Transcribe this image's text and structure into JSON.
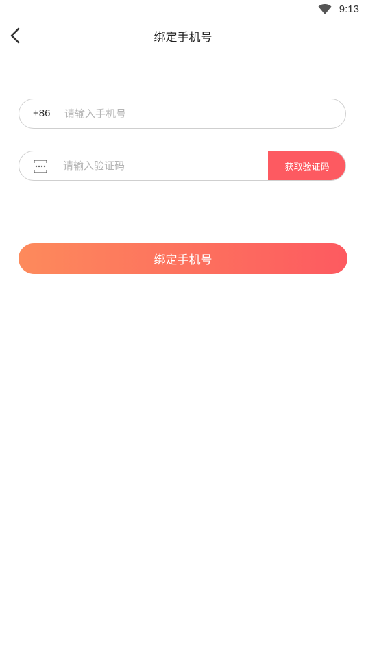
{
  "status_bar": {
    "time": "9:13",
    "wifi_icon": "wifi-icon"
  },
  "header": {
    "back_icon": "chevron-left-icon",
    "title": "绑定手机号"
  },
  "phone_field": {
    "country_code": "+86",
    "value": "",
    "placeholder": "请输入手机号"
  },
  "code_field": {
    "icon": "sms-code-icon",
    "value": "",
    "placeholder": "请输入验证码",
    "get_code_label": "获取验证码"
  },
  "submit": {
    "label": "绑定手机号"
  },
  "colors": {
    "accent": "#fd5a61",
    "gradient_start": "#fd8a5c",
    "gradient_end": "#fd5a60",
    "border": "#cfcfcf",
    "placeholder": "#b5b5b5"
  }
}
